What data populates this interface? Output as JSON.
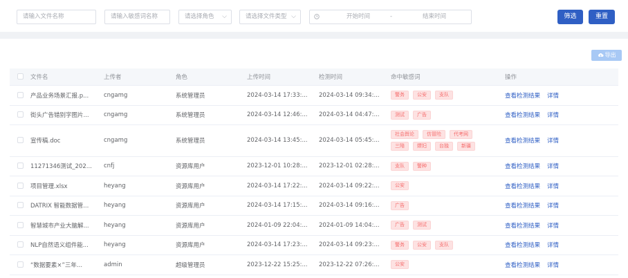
{
  "filters": {
    "file_name_placeholder": "请输入文件名称",
    "sensitive_word_placeholder": "请输入敏感词名称",
    "role_placeholder": "请选择角色",
    "file_type_placeholder": "请选择文件类型",
    "start_time_placeholder": "开始时间",
    "range_separator": "-",
    "end_time_placeholder": "结束时间",
    "filter_button": "筛选",
    "reset_button": "重置"
  },
  "toolbar": {
    "export_label": "导出"
  },
  "table": {
    "headers": {
      "name": "文件名",
      "uploader": "上传者",
      "role": "角色",
      "upload_time": "上传时间",
      "check_time": "检测时间",
      "hits": "命中敏感词",
      "actions": "操作"
    },
    "rows": [
      {
        "name": "产品业务场景汇报.p...",
        "uploader": "cngamg",
        "role": "系统管理员",
        "upload_time": "2024-03-14 17:33:...",
        "check_time": "2024-03-14 09:34:...",
        "tags": [
          [
            "警务",
            "公安",
            "支队"
          ]
        ]
      },
      {
        "name": "街头广告错别字图片...",
        "uploader": "cngamg",
        "role": "系统管理员",
        "upload_time": "2024-03-14 12:46:...",
        "check_time": "2024-03-14 04:47:...",
        "tags": [
          [
            "测试",
            "广告"
          ]
        ]
      },
      {
        "name": "宣传稿.doc",
        "uploader": "cngamg",
        "role": "系统管理员",
        "upload_time": "2024-03-14 13:45:...",
        "check_time": "2024-03-14 05:45:...",
        "tags": [
          [
            "社会舆论",
            "仿冒险",
            "代考网"
          ],
          [
            "三陪",
            "嫖妇",
            "台独",
            "新疆"
          ]
        ]
      },
      {
        "name": "11271346测试_202...",
        "uploader": "cnfj",
        "role": "资源库用户",
        "upload_time": "2023-12-01 10:28:...",
        "check_time": "2023-12-01 02:28:...",
        "tags": [
          [
            "支队",
            "警种"
          ]
        ]
      },
      {
        "name": "项目管理.xlsx",
        "uploader": "heyang",
        "role": "资源库用户",
        "upload_time": "2024-03-14 17:22:...",
        "check_time": "2024-03-14 09:22:...",
        "tags": [
          [
            "公安"
          ]
        ]
      },
      {
        "name": "DATRIX 智能数据管...",
        "uploader": "heyang",
        "role": "资源库用户",
        "upload_time": "2024-03-14 17:15:...",
        "check_time": "2024-03-14 09:16:...",
        "tags": [
          [
            "广告"
          ]
        ]
      },
      {
        "name": "智慧城市产业大脑解...",
        "uploader": "heyang",
        "role": "资源库用户",
        "upload_time": "2024-01-09 22:04:...",
        "check_time": "2024-01-09 14:04:...",
        "tags": [
          [
            "广告",
            "测试"
          ]
        ]
      },
      {
        "name": "NLP自然语义组件能...",
        "uploader": "heyang",
        "role": "资源库用户",
        "upload_time": "2024-03-14 17:23:...",
        "check_time": "2024-03-14 09:23:...",
        "tags": [
          [
            "警务",
            "公安",
            "支队"
          ]
        ]
      },
      {
        "name": "“数据要素×”三年...",
        "uploader": "admin",
        "role": "超级管理员",
        "upload_time": "2023-12-22 15:25:...",
        "check_time": "2023-12-22 07:26:...",
        "tags": [
          [
            "公安"
          ]
        ]
      }
    ],
    "view_result_label": "查看检测结果",
    "detail_label": "详情"
  },
  "colors": {
    "primary": "#2f5fc4",
    "tag_bg": "#fde2e2",
    "tag_text": "#f56c6c",
    "export_bg": "#a8c9f5"
  }
}
